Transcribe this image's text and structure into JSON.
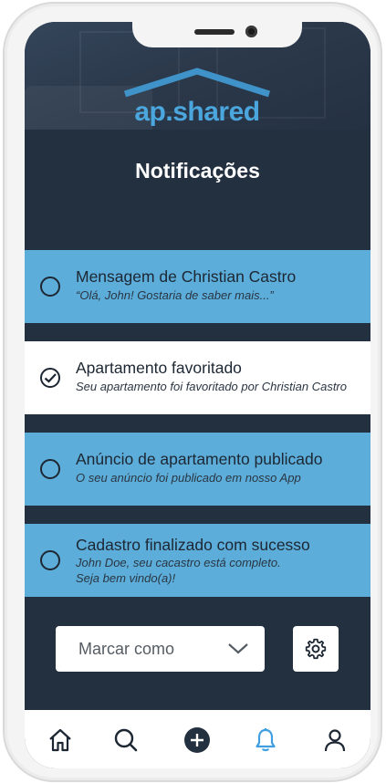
{
  "app": {
    "logo_text": "ap.shared",
    "page_title": "Notificações"
  },
  "colors": {
    "background": "#233040",
    "unread_bg": "#5cadd9",
    "read_bg": "#ffffff",
    "accent": "#4aa6dc",
    "active_tab": "#3f9fe0"
  },
  "notifications": [
    {
      "title": "Mensagem de Christian Castro",
      "message_lines": [
        "“Olá, John! Gostaria de saber mais...”"
      ],
      "read": false,
      "status_icon": "circle-unchecked-icon"
    },
    {
      "title": "Apartamento favoritado",
      "message_lines": [
        "Seu apartamento foi favoritado por Christian Castro"
      ],
      "read": true,
      "status_icon": "check-circle-icon"
    },
    {
      "title": "Anúncio de apartamento publicado",
      "message_lines": [
        "O seu anúncio foi publicado em nosso App"
      ],
      "read": false,
      "status_icon": "circle-unchecked-icon"
    },
    {
      "title": "Cadastro finalizado com sucesso",
      "message_lines": [
        "John Doe, seu cacastro está completo.",
        "Seja bem vindo(a)!"
      ],
      "read": false,
      "status_icon": "circle-unchecked-icon"
    }
  ],
  "controls": {
    "select_label": "Marcar como",
    "select_icon": "chevron-down-icon",
    "settings_icon": "gear-icon"
  },
  "tabbar": {
    "items": [
      {
        "name": "home",
        "icon": "home-icon",
        "active": false
      },
      {
        "name": "search",
        "icon": "search-icon",
        "active": false
      },
      {
        "name": "add",
        "icon": "plus-circle-icon",
        "active": false
      },
      {
        "name": "notifications",
        "icon": "bell-icon",
        "active": true
      },
      {
        "name": "profile",
        "icon": "user-icon",
        "active": false
      }
    ]
  }
}
